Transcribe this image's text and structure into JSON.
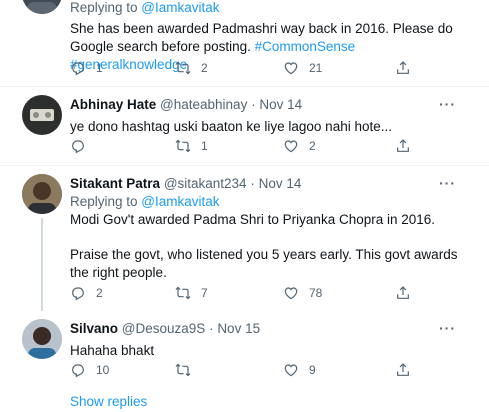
{
  "tweets": [
    {
      "replying_prefix": "Replying to ",
      "replying_handle": "@Iamkavitak",
      "text": "She has been awarded Padmashri way back in 2016. Please do Google search before posting. ",
      "hashtags": "#CommonSense #generalknowledge",
      "replies": "1",
      "retweets": "2",
      "likes": "21"
    },
    {
      "name": "Abhinay Hate",
      "handle": "@hateabhinay",
      "sep": "·",
      "date": "Nov 14",
      "more": "···",
      "text": "ye dono hashtag uski baaton ke liye lagoo nahi hote...",
      "replies": "",
      "retweets": "1",
      "likes": "2"
    },
    {
      "name": "Sitakant Patra",
      "handle": "@sitakant234",
      "sep": "·",
      "date": "Nov 14",
      "more": "···",
      "replying_prefix": "Replying to ",
      "replying_handle": "@Iamkavitak",
      "text1": "Modi Gov't awarded Padma Shri to Priyanka Chopra in 2016.",
      "text2": "Praise the govt, who listened you 5 years early. This govt awards the right people.",
      "replies": "2",
      "retweets": "7",
      "likes": "78"
    },
    {
      "name": "Silvano",
      "handle": "@Desouza9S",
      "sep": "·",
      "date": "Nov 15",
      "more": "···",
      "text": "Hahaha bhakt",
      "replies": "10",
      "retweets": "",
      "likes": "9"
    }
  ],
  "show_replies": "Show replies",
  "icons": {
    "reply": "reply-icon",
    "retweet": "retweet-icon",
    "like": "heart-icon",
    "share": "share-icon"
  },
  "colors": {
    "link": "#1d9bf0",
    "muted": "#536471",
    "text": "#0f1419"
  }
}
